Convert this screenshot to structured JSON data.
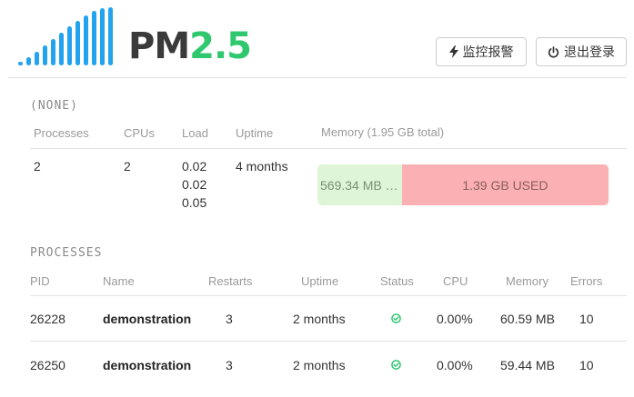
{
  "header": {
    "logo_text": "PM",
    "logo_version": "2.5",
    "monitor_button_label": "监控报警",
    "logout_button_label": "退出登录"
  },
  "server": {
    "name": "(NONE)",
    "columns": {
      "processes": "Processes",
      "cpus": "CPUs",
      "load": "Load",
      "uptime": "Uptime",
      "memory": "Memory (1.95 GB total)"
    },
    "values": {
      "processes": "2",
      "cpus": "2",
      "load": [
        "0.02",
        "0.02",
        "0.05"
      ],
      "uptime": "4 months",
      "memory_free": "569.34 MB …",
      "memory_used": "1.39 GB USED",
      "memory_used_fraction": 0.71
    }
  },
  "processes": {
    "title": "PROCESSES",
    "columns": {
      "pid": "PID",
      "name": "Name",
      "restarts": "Restarts",
      "uptime": "Uptime",
      "status": "Status",
      "cpu": "CPU",
      "memory": "Memory",
      "errors": "Errors"
    },
    "rows": [
      {
        "pid": "26228",
        "name": "demonstration",
        "restarts": "3",
        "uptime": "2 months",
        "status": "online",
        "cpu": "0.00%",
        "memory": "60.59 MB",
        "errors": "10"
      },
      {
        "pid": "26250",
        "name": "demonstration",
        "restarts": "3",
        "uptime": "2 months",
        "status": "online",
        "cpu": "0.00%",
        "memory": "59.44 MB",
        "errors": "10"
      }
    ]
  },
  "colors": {
    "brand_blue": "#21a3ef",
    "brand_green": "#2fc86f",
    "memory_free": "#dff5d7",
    "memory_used": "#fbb0b3",
    "status_online": "#2fc86f"
  },
  "icons": {
    "monitor_button": "bolt-icon",
    "logout_button": "power-icon",
    "status_online": "check-circle-icon"
  }
}
